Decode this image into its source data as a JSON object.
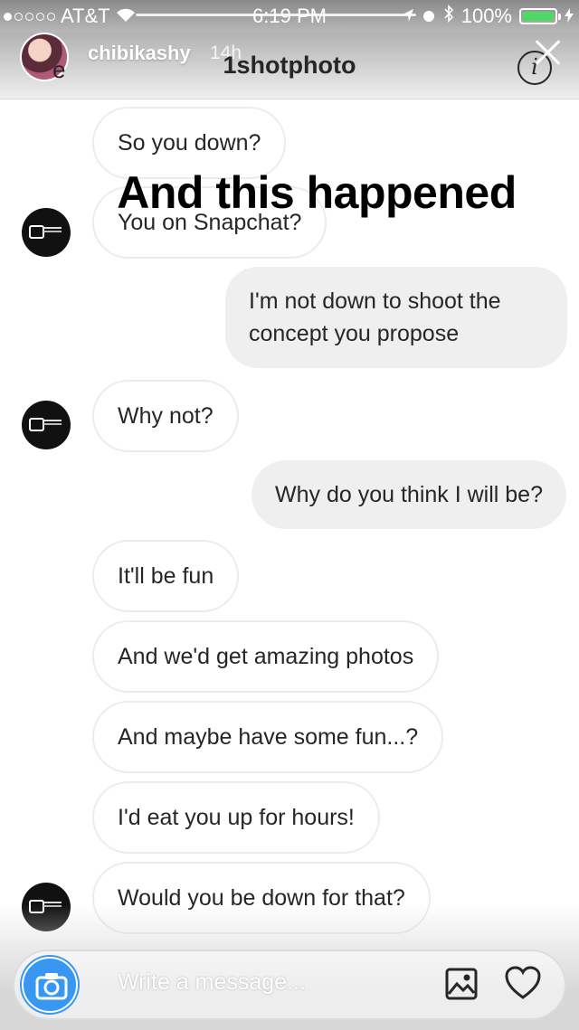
{
  "status_bar": {
    "carrier": "AT&T",
    "time": "6:19 PM",
    "battery": "100%",
    "battery_level": 1.0
  },
  "story": {
    "username": "chibikashy",
    "age": "14h",
    "overlay_caption": "And this happened"
  },
  "thread_header": {
    "back_label": "e",
    "title": "1shotphoto"
  },
  "messages": [
    {
      "side": "in",
      "text": "So you down?"
    },
    {
      "side": "in",
      "text": "You on Snapchat?"
    },
    {
      "side": "out",
      "text": "I'm not down to shoot the concept you propose"
    },
    {
      "side": "in",
      "text": "Why not?"
    },
    {
      "side": "out",
      "text": "Why do you think I will be?"
    },
    {
      "side": "in",
      "text": "It'll be fun"
    },
    {
      "side": "in",
      "text": "And we'd get amazing photos"
    },
    {
      "side": "in",
      "text": "And maybe have some fun...?"
    },
    {
      "side": "in",
      "text": "I'd eat you up for hours!"
    },
    {
      "side": "in",
      "text": "Would you be down for that?"
    }
  ],
  "composer": {
    "placeholder": "Write a message..."
  },
  "colors": {
    "accent": "#3897f0",
    "incoming_bubble_border": "#ececec",
    "outgoing_bubble_bg": "#efefef"
  }
}
